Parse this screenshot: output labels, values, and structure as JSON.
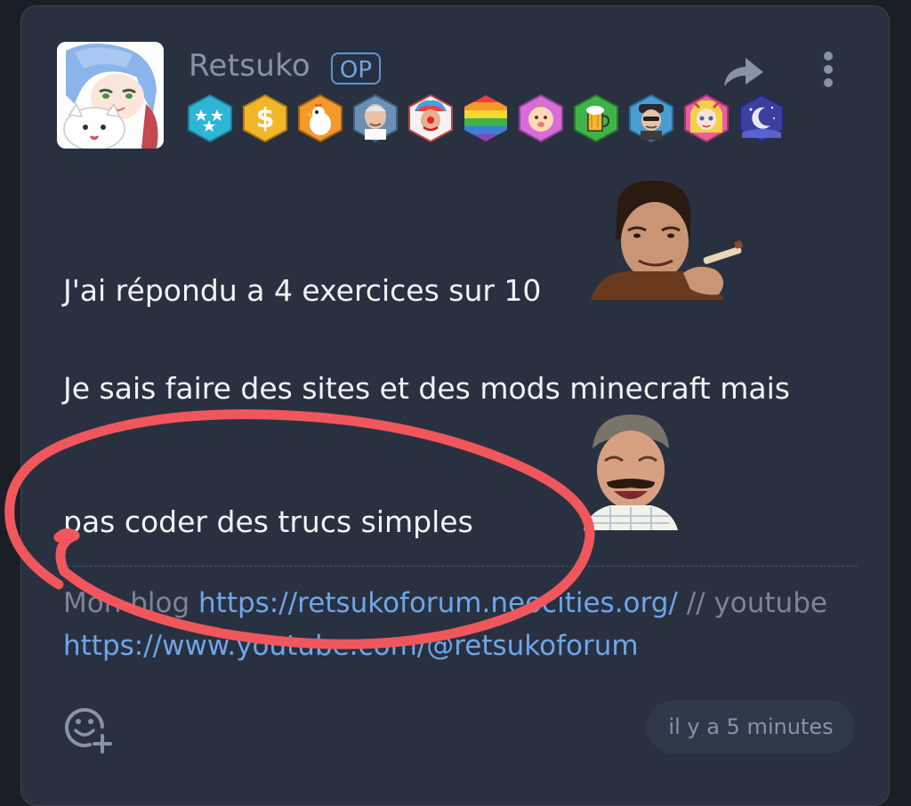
{
  "post": {
    "author": {
      "username": "Retsuko",
      "op_badge": "OP",
      "avatar": "anime-girl-avatar"
    },
    "badges": [
      {
        "name": "stars-badge",
        "color": "#2fb6d6"
      },
      {
        "name": "dollar-badge",
        "color": "#f2b62a"
      },
      {
        "name": "chicken-badge",
        "color": "#f29a2a"
      },
      {
        "name": "harold-badge",
        "color": "#6b8fb5"
      },
      {
        "name": "clown-badge",
        "color": "#e8443c"
      },
      {
        "name": "rainbow-badge",
        "color": "#e9503e"
      },
      {
        "name": "baby-emoji-badge",
        "color": "#d66dd9"
      },
      {
        "name": "beer-badge",
        "color": "#3fb34a"
      },
      {
        "name": "man-face-badge",
        "color": "#4a9cd4"
      },
      {
        "name": "anime-girl-badge",
        "color": "#e85fa0"
      },
      {
        "name": "moon-night-badge",
        "color": "#3b3f9e"
      }
    ],
    "body": {
      "line1": "J'ai répondu a 4 exercices sur 10",
      "line2": "Je sais faire des sites et des mods minecraft mais",
      "line3": "pas coder des trucs simples"
    },
    "signature": {
      "prefix": "Mon blog ",
      "blog_url": "https://retsukoforum.neocities.org/",
      "separator": " // youtube",
      "youtube_url": "https://www.youtube.com/@retsukoforum"
    },
    "timestamp": "il y a 5 minutes"
  },
  "colors": {
    "card_bg": "#293141",
    "link": "#6ea6e8",
    "annotation_circle": "#f0575c"
  }
}
